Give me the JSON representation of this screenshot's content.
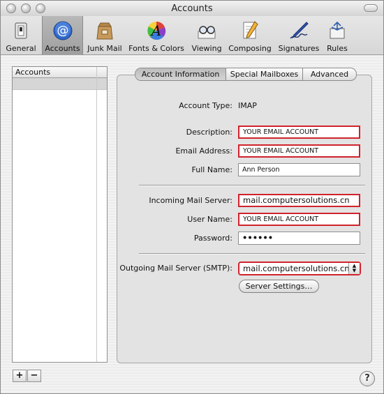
{
  "window": {
    "title": "Accounts"
  },
  "toolbar": {
    "items": [
      {
        "label": "General",
        "icon": "general-switch-icon"
      },
      {
        "label": "Accounts",
        "icon": "at-sign-icon",
        "selected": true
      },
      {
        "label": "Junk Mail",
        "icon": "junk-mail-bag-icon"
      },
      {
        "label": "Fonts & Colors",
        "icon": "fonts-colors-icon"
      },
      {
        "label": "Viewing",
        "icon": "viewing-glasses-icon"
      },
      {
        "label": "Composing",
        "icon": "composing-pencil-icon"
      },
      {
        "label": "Signatures",
        "icon": "signature-pen-icon"
      },
      {
        "label": "Rules",
        "icon": "rules-envelope-icon"
      }
    ]
  },
  "sidebar": {
    "header": "Accounts",
    "add_label": "+",
    "remove_label": "−"
  },
  "tabs": [
    {
      "label": "Account Information",
      "active": true
    },
    {
      "label": "Special Mailboxes"
    },
    {
      "label": "Advanced"
    }
  ],
  "form": {
    "account_type_label": "Account Type:",
    "account_type_value": "IMAP",
    "description_label": "Description:",
    "description_value": "YOUR EMAIL ACCOUNT",
    "email_label": "Email Address:",
    "email_value": "YOUR EMAIL ACCOUNT",
    "fullname_label": "Full Name:",
    "fullname_value": "Ann Person",
    "incoming_label": "Incoming Mail Server:",
    "incoming_value": "mail.computersolutions.cn",
    "username_label": "User Name:",
    "username_value": "YOUR EMAIL ACCOUNT",
    "password_label": "Password:",
    "password_value": "••••••",
    "smtp_label": "Outgoing Mail Server (SMTP):",
    "smtp_value": "mail.computersolutions.cn",
    "server_settings_label": "Server Settings…"
  },
  "help": {
    "label": "?"
  },
  "colors": {
    "error_border": "#d1222c",
    "selected_tool": "#a8a8a8"
  }
}
